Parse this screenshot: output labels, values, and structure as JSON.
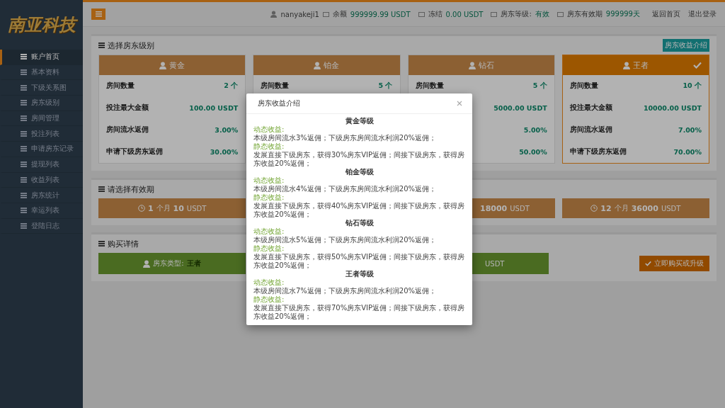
{
  "sidebar": {
    "logo": "南亚科技",
    "items": [
      {
        "label": "账户首页",
        "selected": true
      },
      {
        "label": "基本资料",
        "selected": false
      },
      {
        "label": "下级关系图",
        "selected": false
      },
      {
        "label": "房东级别",
        "selected": false
      },
      {
        "label": "房间管理",
        "selected": false
      },
      {
        "label": "投注列表",
        "selected": false
      },
      {
        "label": "申请房东记录",
        "selected": false
      },
      {
        "label": "提现列表",
        "selected": false
      },
      {
        "label": "收益列表",
        "selected": false
      },
      {
        "label": "房东统计",
        "selected": false
      },
      {
        "label": "幸运列表",
        "selected": false
      },
      {
        "label": "登陆日志",
        "selected": false
      }
    ]
  },
  "topbar": {
    "user": "nanyakeji1",
    "stats": [
      {
        "label": "余额",
        "value": "999999.99 USDT"
      },
      {
        "label": "冻结",
        "value": "0.00 USDT"
      },
      {
        "label": "房东等级:",
        "value": "有效"
      },
      {
        "label": "房东有效期",
        "value": "999999天"
      }
    ],
    "links": [
      "返回首页",
      "退出登录"
    ]
  },
  "levels": {
    "title": "选择房东级别",
    "intro_button": "房东收益介绍",
    "cards": [
      {
        "name": "黄金",
        "selected": false,
        "rows": [
          {
            "label": "房间数量",
            "value": "2 个"
          },
          {
            "label": "投注最大金额",
            "value": "100.00 USDT"
          },
          {
            "label": "房间流水返佣",
            "value": "3.00%"
          },
          {
            "label": "申请下级房东返佣",
            "value": "30.00%"
          }
        ]
      },
      {
        "name": "铂金",
        "selected": false,
        "rows": [
          {
            "label": "房间数量",
            "value": "5 个"
          }
        ]
      },
      {
        "name": "钻石",
        "selected": false,
        "rows": [
          {
            "label": "房间数量",
            "value": "5 个"
          },
          {
            "value": "5000.00 USDT"
          },
          {
            "value": "5.00%"
          },
          {
            "value": "50.00%"
          }
        ]
      },
      {
        "name": "王者",
        "selected": true,
        "rows": [
          {
            "label": "房间数量",
            "value": "10 个"
          },
          {
            "label": "投注最大金额",
            "value": "10000.00 USDT"
          },
          {
            "label": "房间流水返佣",
            "value": "7.00%"
          },
          {
            "label": "申请下级房东返佣",
            "value": "70.00%"
          }
        ]
      }
    ]
  },
  "periods": {
    "title": "请选择有效期",
    "cards": [
      {
        "months": "1",
        "unit": "个月",
        "price": "10",
        "currency": "USDT"
      },
      {
        "price": "18000",
        "currency": "USDT"
      },
      {
        "months": "12",
        "unit": "个月",
        "price": "36000",
        "currency": "USDT"
      }
    ]
  },
  "purchase": {
    "title": "购买详情",
    "type_label": "房东类型:",
    "type_value": "王者",
    "price_tail": "USDT",
    "button": "立即购买或升级"
  },
  "modal": {
    "title": "房东收益介绍",
    "sections": [
      {
        "heading": "黄金等级",
        "dynamic_label": "动态收益:",
        "dynamic_text": "本级房间流水3%返佣；下级房东房间流水利润20%返佣；",
        "static_label": "静态收益:",
        "static_text": "发展直接下级房东，获得30%房东VIP返佣；间接下级房东，获得房东收益20%返佣；"
      },
      {
        "heading": "铂金等级",
        "dynamic_label": "动态收益:",
        "dynamic_text": "本级房间流水4%返佣；下级房东房间流水利润20%返佣；",
        "static_label": "静态收益:",
        "static_text": "发展直接下级房东，获得40%房东VIP返佣；间接下级房东，获得房东收益20%返佣；"
      },
      {
        "heading": "钻石等级",
        "dynamic_label": "动态收益:",
        "dynamic_text": "本级房间流水5%返佣；下级房东房间流水利润20%返佣；",
        "static_label": "静态收益:",
        "static_text": "发展直接下级房东，获得50%房东VIP返佣；间接下级房东，获得房东收益20%返佣；"
      },
      {
        "heading": "王者等级",
        "dynamic_label": "动态收益:",
        "dynamic_text": "本级房间流水7%返佣；下级房东房间流水利润20%返佣；",
        "static_label": "静态收益:",
        "static_text": "发展直接下级房东，获得70%房东VIP返佣；间接下级房东，获得房东收益20%返佣；"
      }
    ]
  }
}
